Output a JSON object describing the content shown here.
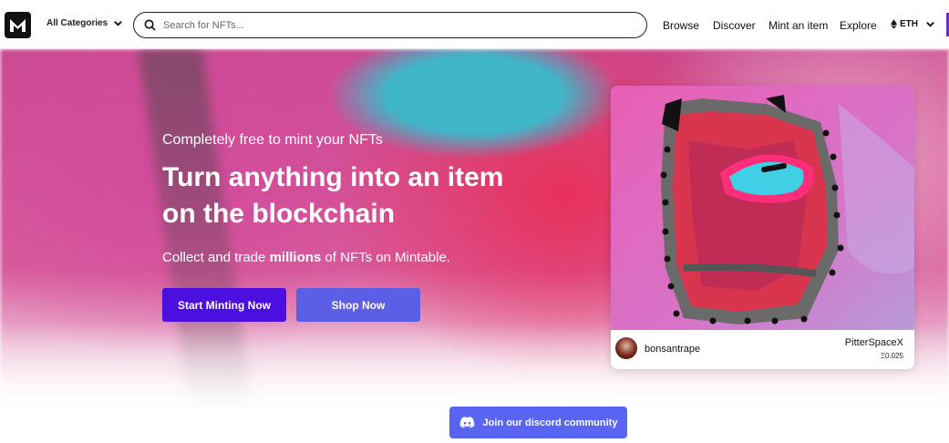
{
  "header": {
    "logo_icon": "mintable-logo-icon",
    "categories_label": "All Categories",
    "search_placeholder": "Search for NFTs...",
    "nav": [
      "Browse",
      "Discover",
      "Mint an item",
      "Explore"
    ],
    "currency": "ETH"
  },
  "hero": {
    "subtitle": "Completely free to mint your NFTs",
    "title_line1": "Turn anything into an item",
    "title_line2": "on the blockchain",
    "tagline_before": "Collect and trade ",
    "tagline_bold": "millions",
    "tagline_after": " of NFTs on Mintable.",
    "mint_button": "Start Minting Now",
    "shop_button": "Shop Now"
  },
  "featured": {
    "creator": "bonsantrape",
    "item_name": "PitterSpaceX",
    "price": "Ξ0.025"
  },
  "discord": {
    "label": "Join our discord community",
    "icon": "discord-icon"
  },
  "colors": {
    "primary_button": "#4b10e0",
    "secondary_button": "#5a5fe6",
    "discord": "#5865f2"
  }
}
